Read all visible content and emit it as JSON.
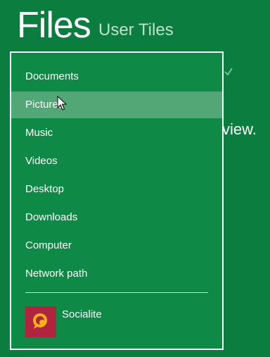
{
  "header": {
    "title": "Files",
    "subtitle": "User Tiles"
  },
  "background": {
    "partial_text": "view.",
    "check_icon": "checkmark-icon"
  },
  "menu": {
    "items": [
      {
        "label": "Documents"
      },
      {
        "label": "Pictures",
        "hovered": true
      },
      {
        "label": "Music"
      },
      {
        "label": "Videos"
      },
      {
        "label": "Desktop"
      },
      {
        "label": "Downloads"
      },
      {
        "label": "Computer"
      },
      {
        "label": "Network path"
      }
    ],
    "apps": [
      {
        "label": "Socialite",
        "icon": "socialite-app-icon",
        "tile_color": "#b0243f"
      }
    ]
  },
  "colors": {
    "background": "#0b7d3e",
    "menu_background": "#0f8a46",
    "hover": "#53a675"
  }
}
